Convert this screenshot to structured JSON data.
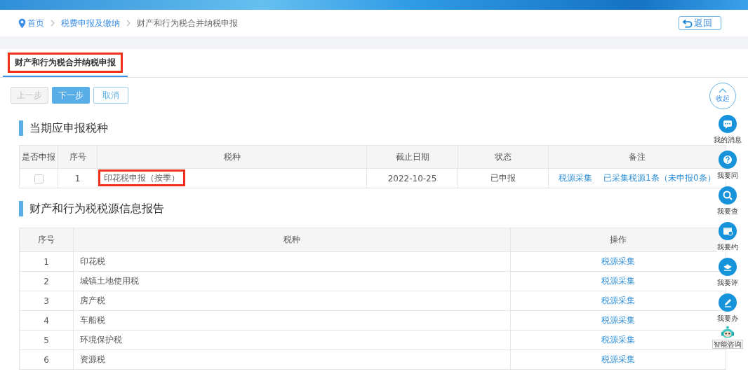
{
  "breadcrumb": [
    {
      "label": "首页",
      "kind": "home"
    },
    {
      "label": "税费申报及缴纳",
      "kind": "link"
    },
    {
      "label": "财产和行为税合并纳税申报",
      "kind": "current"
    }
  ],
  "back_button": {
    "label": "返回"
  },
  "tabs": [
    {
      "label": "财产和行为税合并纳税申报",
      "selected": true,
      "highlighted": true
    }
  ],
  "buttons": [
    {
      "label": "上一步",
      "kind": "disabled"
    },
    {
      "label": "下一步",
      "kind": "primary"
    },
    {
      "label": "取消",
      "kind": "default"
    }
  ],
  "declare_section": {
    "title": "当期应申报税种",
    "columns": [
      "是否申报",
      "序号",
      "税种",
      "截止日期",
      "状态",
      "备注"
    ],
    "rows": [
      {
        "checked": false,
        "index": "1",
        "tax": "印花税申报（按季）",
        "highlighted": true,
        "deadline": "2022-10-25",
        "status": "已申报",
        "notes": [
          "税源采集",
          "已采集税源1条（未申报0条）"
        ]
      }
    ]
  },
  "source_section": {
    "title": "财产和行为税税源信息报告",
    "columns": [
      "序号",
      "税种",
      "操作"
    ],
    "rows": [
      {
        "index": "1",
        "tax": "印花税",
        "action": "税源采集"
      },
      {
        "index": "2",
        "tax": "城镇土地使用税",
        "action": "税源采集"
      },
      {
        "index": "3",
        "tax": "房产税",
        "action": "税源采集"
      },
      {
        "index": "4",
        "tax": "车船税",
        "action": "税源采集"
      },
      {
        "index": "5",
        "tax": "环境保护税",
        "action": "税源采集"
      },
      {
        "index": "6",
        "tax": "资源税",
        "action": "税源采集"
      }
    ]
  },
  "side_toolbar": {
    "collapse": "收起",
    "items": [
      {
        "label": "我的消息",
        "kind": "message"
      },
      {
        "label": "我要问",
        "kind": "question"
      },
      {
        "label": "我要查",
        "kind": "search"
      },
      {
        "label": "我要约",
        "kind": "calendar"
      },
      {
        "label": "我要评",
        "kind": "rate"
      },
      {
        "label": "我要办",
        "kind": "edit"
      }
    ],
    "assistant": "智能咨询"
  }
}
